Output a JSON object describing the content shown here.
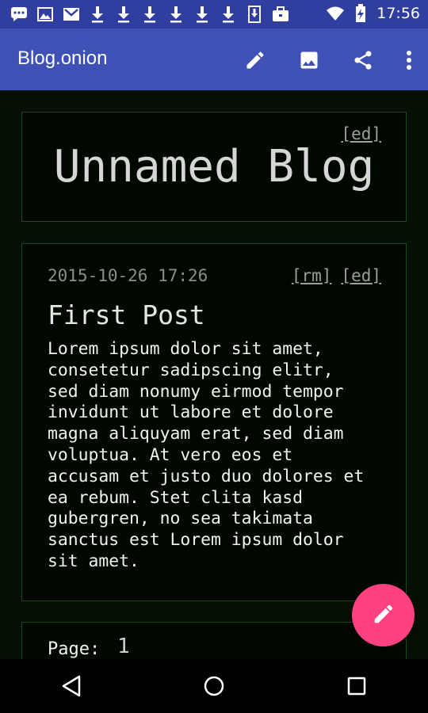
{
  "status_bar": {
    "time": "17:56",
    "left_icons": [
      "chat-icon",
      "image-icon",
      "gmail-icon",
      "download-icon",
      "download-icon",
      "download-icon",
      "download-icon",
      "download-icon",
      "download-icon",
      "download-box-icon",
      "briefcase-icon"
    ],
    "right_icons": [
      "wifi-icon",
      "battery-charging-icon"
    ]
  },
  "app_bar": {
    "title": "Blog.onion",
    "actions": [
      "edit-icon",
      "image-icon",
      "share-icon",
      "more-vert-icon"
    ]
  },
  "blog": {
    "ed_link": "[ed]",
    "title": "Unnamed Blog"
  },
  "post": {
    "date": "2015-10-26 17:26",
    "rm_link": "[rm]",
    "ed_link": "[ed]",
    "title": "First Post",
    "body_lines": [
      "Lorem ipsum dolor sit amet,",
      "consetetur sadipscing elitr,",
      "sed diam nonumy eirmod tempor",
      "invidunt ut labore et dolore",
      "magna aliquyam erat, sed diam",
      "voluptua. At vero eos et",
      "accusam et justo duo dolores et",
      "ea rebum. Stet clita kasd",
      "gubergren, no sea takimata",
      "sanctus est Lorem ipsum dolor",
      "sit amet."
    ]
  },
  "pager": {
    "label": "Page:",
    "value": "1"
  },
  "colors": {
    "status_bar": "#303f9f",
    "app_bar": "#3f51b5",
    "background": "#031003",
    "card_border": "#1b4a1b",
    "fab": "#ff4081"
  },
  "fab": {
    "icon": "edit-icon"
  },
  "nav_bar": {
    "buttons": [
      "back-icon",
      "home-icon",
      "recents-icon"
    ]
  }
}
